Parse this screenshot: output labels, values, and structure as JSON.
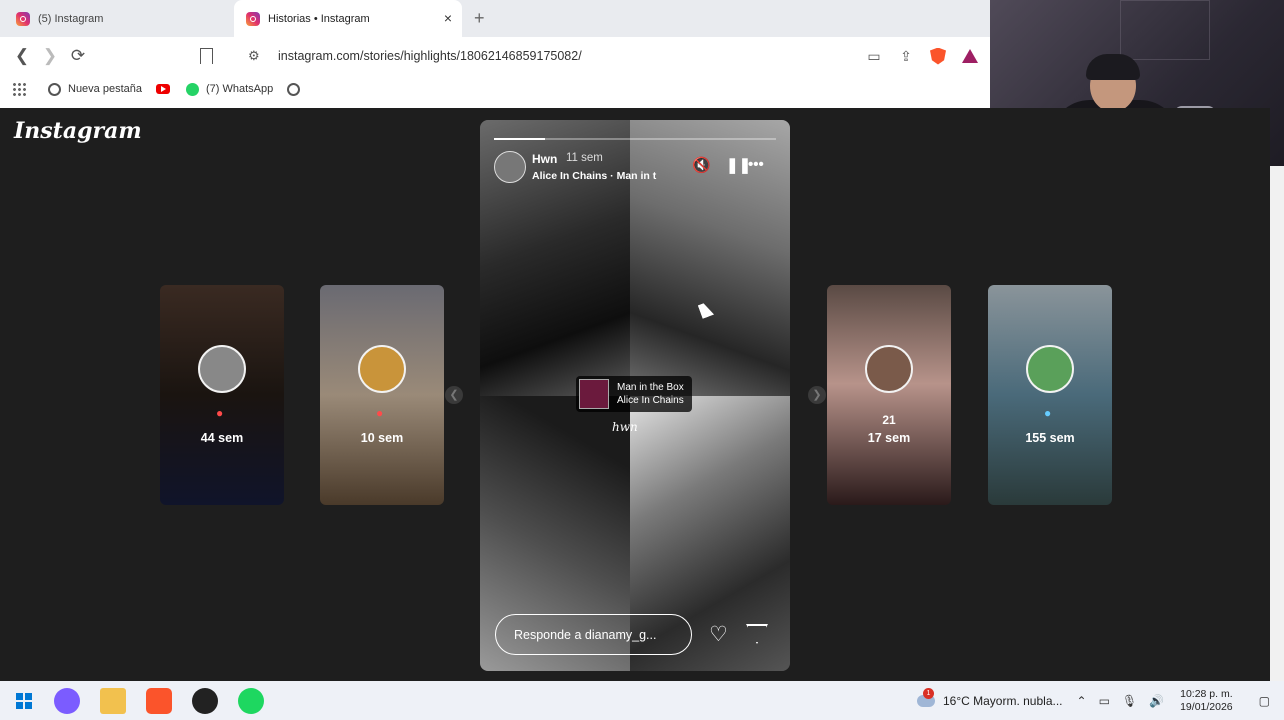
{
  "browser": {
    "tabs": [
      {
        "label": "(5) Instagram",
        "active": false
      },
      {
        "label": "Historias • Instagram",
        "active": true
      }
    ],
    "new_tab": "+",
    "tab_close": "×",
    "url": "instagram.com/stories/highlights/18062146859175082/",
    "bookmarks": [
      "Nueva pestaña",
      "(7) WhatsApp"
    ]
  },
  "instagram": {
    "logo": "Instagram",
    "side_cards": [
      {
        "label": "44 sem",
        "num": ""
      },
      {
        "label": "10 sem",
        "num": ""
      },
      {
        "label": "17 sem",
        "num": "21"
      },
      {
        "label": "155 sem",
        "num": ""
      }
    ],
    "story": {
      "username": "Hwn",
      "time": "11 sem",
      "song_line": "Alice In Chains · Man in t",
      "progress": 0.18,
      "music_title": "Man in the Box",
      "music_artist": "Alice In Chains",
      "caption": "hwn",
      "reply_placeholder": "Responde a dianamy_g..."
    }
  },
  "taskbar": {
    "weather": "16°C  Mayorm. nubla...",
    "time": "10:28 p. m.",
    "date": "19/01/2026"
  },
  "colors": {
    "accent_ig": "#e1306c",
    "brave": "#fb542b"
  }
}
